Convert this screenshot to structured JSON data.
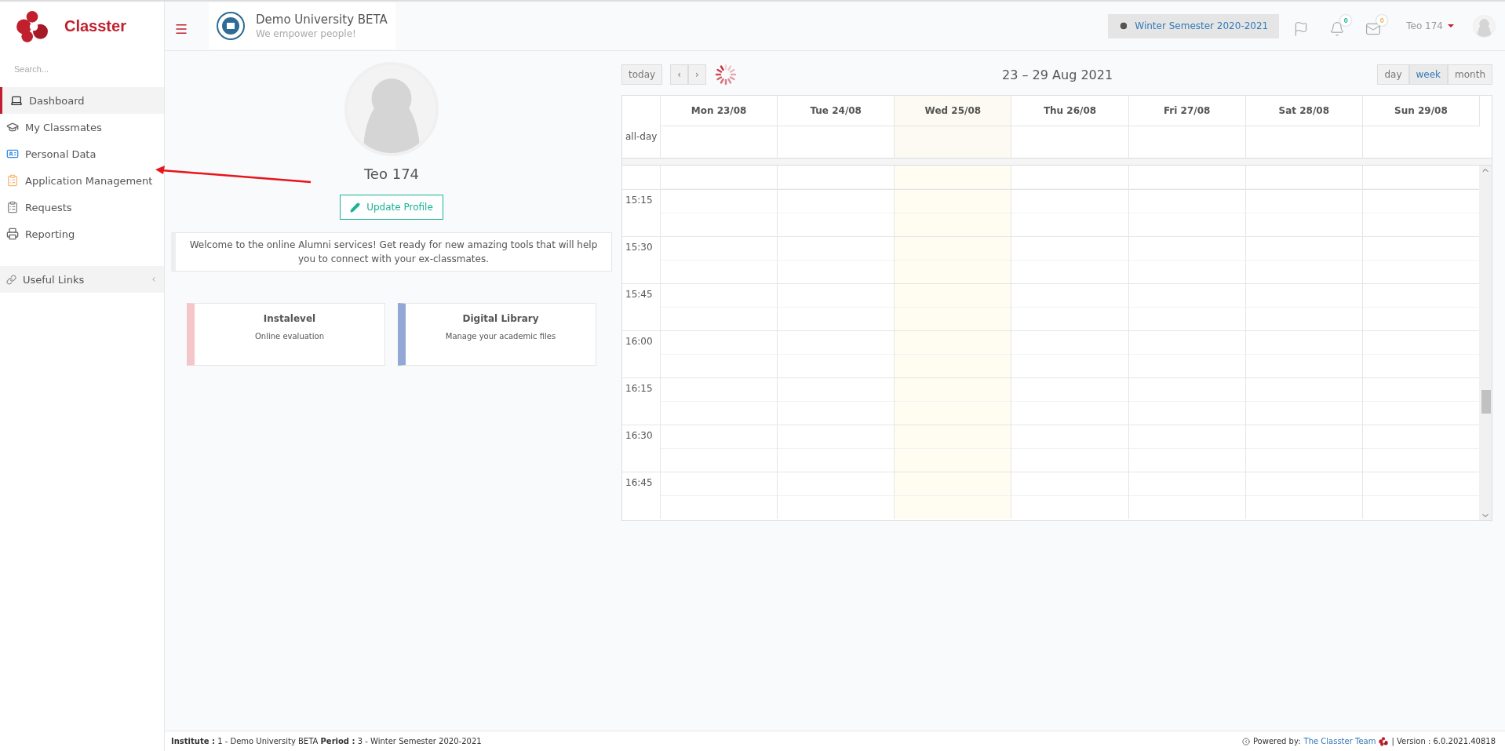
{
  "brand": {
    "name": "Classter"
  },
  "sidebar": {
    "search": {
      "placeholder": "Search..."
    },
    "items": [
      {
        "kind": "laptop",
        "label": "Dashboard",
        "selected": true
      },
      {
        "kind": "cap",
        "label": "My Classmates",
        "selected": false
      },
      {
        "kind": "card",
        "label": "Personal Data",
        "selected": false
      },
      {
        "kind": "forms",
        "label": "Application Management",
        "selected": false
      },
      {
        "kind": "list",
        "label": "Requests",
        "selected": false
      },
      {
        "kind": "printer",
        "label": "Reporting",
        "selected": false
      }
    ],
    "links_section": {
      "label": "Useful Links",
      "expanded": false
    }
  },
  "header": {
    "title": "Demo University BETA",
    "subtitle": "We empower people!",
    "period": "Winter Semester 2020-2021",
    "badges": [
      {
        "kind": "bell",
        "count": "0",
        "color": "#1ab394"
      },
      {
        "kind": "mail",
        "count": "0",
        "color": "#f8ac59"
      }
    ],
    "user": "Teo 174"
  },
  "profile": {
    "name": "Teo 174",
    "button": "Update Profile",
    "welcome": "Welcome to the online Alumni services! Get ready for new amazing tools that will help you to connect with your ex-classmates.",
    "cards": [
      {
        "title": "Instalevel",
        "subtitle": "Online evaluation",
        "color": "#f5c6c8"
      },
      {
        "title": "Digital Library",
        "subtitle": "Manage your academic files",
        "color": "#93a8d4"
      }
    ]
  },
  "calendar": {
    "today_button": "today",
    "prev": "‹",
    "next": "›",
    "range": "23 – 29 Aug 2021",
    "views": [
      {
        "label": "day",
        "selected": false
      },
      {
        "label": "week",
        "selected": true
      },
      {
        "label": "month",
        "selected": false
      }
    ],
    "allday": "all-day",
    "days": [
      {
        "label": "Mon 23/08",
        "today": false
      },
      {
        "label": "Tue 24/08",
        "today": false
      },
      {
        "label": "Wed 25/08",
        "today": true
      },
      {
        "label": "Thu 26/08",
        "today": false
      },
      {
        "label": "Fri 27/08",
        "today": false
      },
      {
        "label": "Sat 28/08",
        "today": false
      },
      {
        "label": "Sun 29/08",
        "today": false
      }
    ],
    "slots": [
      "15:15",
      "15:30",
      "15:45",
      "16:00",
      "16:15",
      "16:30",
      "16:45"
    ]
  },
  "footer": {
    "left": "**Institute :** 1 - Demo University BETA **Period :** 3 - Winter Semester 2020-2021",
    "powered": "Powered by:",
    "team": "The Classter Team",
    "version": "| Version : 6.0.2021.40818"
  }
}
